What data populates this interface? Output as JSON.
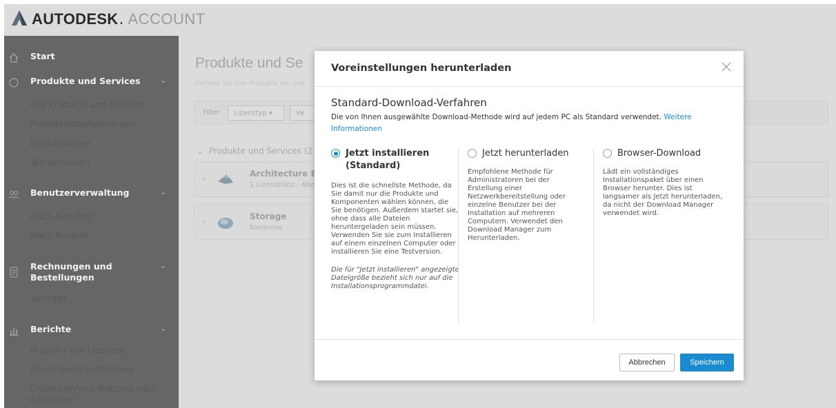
{
  "header": {
    "brand": "AUTODESK",
    "brand_dot": ".",
    "product": "ACCOUNT"
  },
  "sidebar": {
    "sections": [
      {
        "label": "Start",
        "icon": "home-icon",
        "items": []
      },
      {
        "label": "Produkte und Services",
        "icon": "box-icon",
        "items": [
          "Alle Produkte und Services",
          "Produktaktualisierungen",
          "Einrichtungen",
          "Testversionen"
        ]
      },
      {
        "label": "Benutzerverwaltung",
        "icon": "users-icon",
        "items": [
          "Nach Benutzer",
          "Nach Produkt"
        ]
      },
      {
        "label": "Rechnungen und Bestellungen",
        "icon": "document-icon",
        "items": [
          "Verträge"
        ]
      },
      {
        "label": "Berichte",
        "icon": "chart-icon",
        "items": [
          "Nutzung von Lizenzen",
          "Cloud-Services-Nutzung",
          "Cloud-Services-Nutzung nach Benutzern"
        ]
      }
    ]
  },
  "main": {
    "title": "Produkte und Se",
    "subtitle": "Richten Sie Ihre Produkte ein und",
    "filter_label": "Filter",
    "filter_select": "Lizenztyp",
    "filter_select2": "Ve",
    "group_head": "Produkte und Services (2",
    "products": [
      {
        "name": "Architecture Engi",
        "meta": "1 Lizenzplatz · Abo"
      },
      {
        "name": "Storage",
        "meta": "kostenlos"
      }
    ]
  },
  "modal": {
    "title": "Voreinstellungen herunterladen",
    "section_title": "Standard-Download-Verfahren",
    "section_desc": "Die von Ihnen ausgewählte Download-Methode wird auf jedem PC als Standard verwendet.",
    "more_info": "Weitere Informationen",
    "options": [
      {
        "label": "Jetzt installieren (Standard)",
        "selected": true,
        "desc": "Dies ist die schnellste Methode, da Sie damit nur die Produkte und Komponenten wählen können, die Sie benötigen. Außerdem startet sie, ohne dass alle Dateien heruntergeladen sein müssen. Verwenden Sie sie zum Installieren auf einem einzelnen Computer oder installieren Sie eine Testversion.",
        "note": "Die für \"Jetzt installieren\" angezeigte Dateigröße bezieht sich nur auf die Installationsprogrammdatei."
      },
      {
        "label": "Jetzt herunterladen",
        "selected": false,
        "desc": "Empfohlene Methode für Administratoren bei der Erstellung einer Netzwerkbereitstellung oder einzelne Benutzer bei der Installation auf mehreren Computern. Verwendet den Download Manager zum Herunterladen."
      },
      {
        "label": "Browser-Download",
        "selected": false,
        "desc": "Lädt ein vollständiges Installationspaket über einen Browser herunter. Dies ist langsamer als Jetzt herunterladen, da nicht der Download Manager verwendet wird."
      }
    ],
    "cancel_label": "Abbrechen",
    "save_label": "Speichern"
  },
  "colors": {
    "accent": "#1a8bd0",
    "sidebar": "#666666",
    "overlay_bg": "#dcdcdc"
  }
}
